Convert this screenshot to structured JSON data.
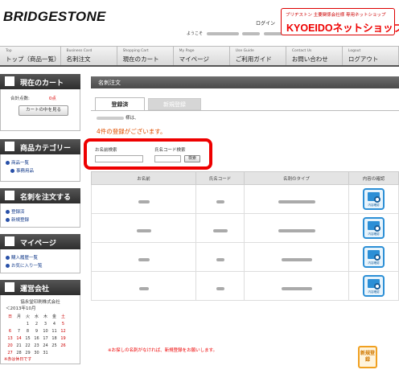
{
  "header": {
    "logo": "BRIDGESTONE",
    "login_link": "ログイン",
    "welcome_prefix": "ようこそ",
    "shop_subtitle": "ブリヂストン 主要関係会社様 専用ネットショップ",
    "shop_name": "KYOEIDOネットショップ"
  },
  "nav": [
    {
      "en": "Top",
      "jp": "トップ（商品一覧）"
    },
    {
      "en": "Business Card",
      "jp": "名刺注文"
    },
    {
      "en": "Shopping Cart",
      "jp": "現在のカート"
    },
    {
      "en": "My Page",
      "jp": "マイページ"
    },
    {
      "en": "Use Guide",
      "jp": "ご利用ガイド"
    },
    {
      "en": "Contact Us",
      "jp": "お問い合わせ"
    },
    {
      "en": "Logout",
      "jp": "ログアウト"
    }
  ],
  "sidebar": {
    "cart": {
      "title": "現在のカート",
      "total_label": "合計点数:",
      "total_value": "0点",
      "button": "カートの中を見る"
    },
    "category": {
      "title": "商品カテゴリー",
      "links": [
        "商品一覧",
        "事務用品"
      ]
    },
    "order": {
      "title": "名刺を注文する",
      "links": [
        "登録済",
        "新規登録"
      ]
    },
    "mypage": {
      "title": "マイページ",
      "links": [
        "購入履歴一覧",
        "お気に入り一覧"
      ]
    },
    "company": {
      "title": "運営会社",
      "name": "協永堂印刷株式会社",
      "month": "＜2013年10月",
      "weekdays": [
        "日",
        "月",
        "火",
        "水",
        "木",
        "金",
        "土"
      ],
      "weeks": [
        [
          "",
          "",
          "1",
          "2",
          "3",
          "4",
          "5"
        ],
        [
          "6",
          "7",
          "8",
          "9",
          "10",
          "11",
          "12"
        ],
        [
          "13",
          "14",
          "15",
          "16",
          "17",
          "18",
          "19"
        ],
        [
          "20",
          "21",
          "22",
          "23",
          "24",
          "25",
          "26"
        ],
        [
          "27",
          "28",
          "29",
          "30",
          "31",
          "",
          ""
        ]
      ],
      "note": "※赤は休日です"
    }
  },
  "main": {
    "title": "名刺注文",
    "tabs": [
      "登録済",
      "新規登録"
    ],
    "user_suffix": "様は、",
    "count_message": "4件の登録がございます。",
    "search": {
      "name_label": "お名前検索",
      "code_label": "氏名コード検索",
      "button": "検索"
    },
    "table": {
      "headers": [
        "お名前",
        "氏名コード",
        "名刺のタイプ",
        "内容の確認"
      ],
      "detail_caption": "内容確認",
      "rows": 4
    },
    "footer_note": "※お探しの名刺がなければ、新規登録をお願いします。",
    "new_button": "新規登録"
  },
  "colors": {
    "accent_red": "#e00000",
    "nav_dark": "#444444",
    "detail_blue": "#2c8fd6",
    "new_orange": "#f0a020"
  }
}
